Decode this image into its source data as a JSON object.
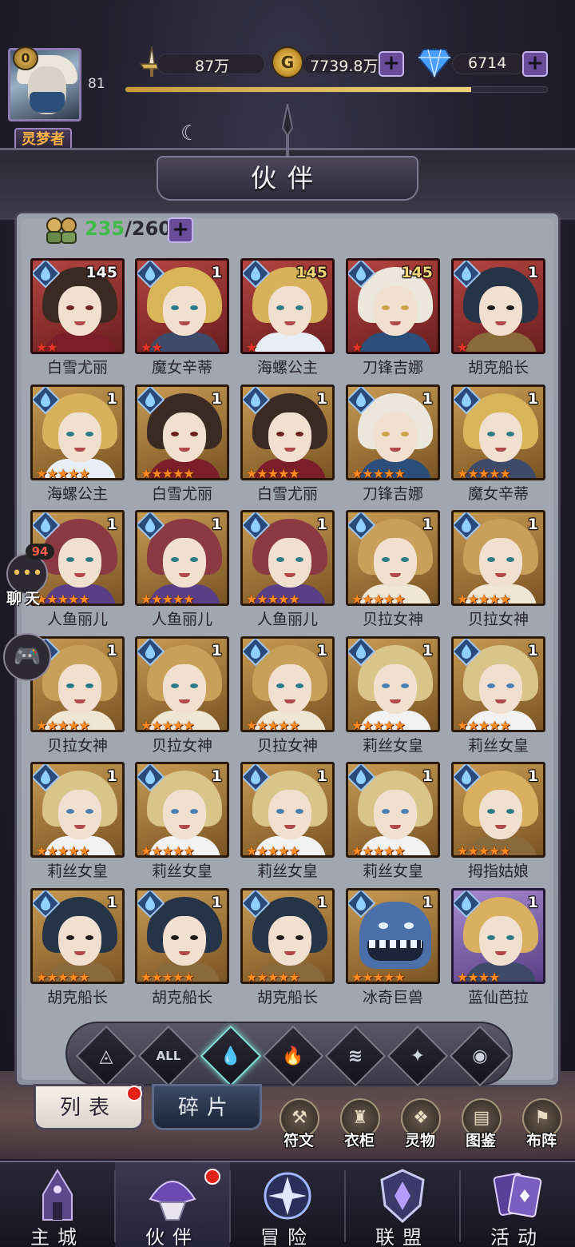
{
  "player": {
    "vip": "0",
    "level": "81",
    "title": "灵梦者",
    "exp_fraction": 0.82
  },
  "resources": {
    "power": "87万",
    "gold": "7739.8万",
    "gems": "6714",
    "plus": "+"
  },
  "page_title": "伙伴",
  "roster": {
    "current": "235",
    "max": "/260",
    "plus": "+"
  },
  "heroes": [
    {
      "name": "白雪尤丽",
      "level": "145",
      "stars": 2,
      "star_color": "red",
      "rarity": "red",
      "hair": "#3b2a24",
      "body": "#7a1f2a",
      "eye": "#6b2420"
    },
    {
      "name": "魔女辛蒂",
      "level": "1",
      "stars": 2,
      "star_color": "red",
      "rarity": "red",
      "hair": "#d9b55a",
      "body": "#3e4a6a",
      "eye": "#2c7b86"
    },
    {
      "name": "海螺公主",
      "level": "145",
      "stars": 1,
      "star_color": "red",
      "rarity": "red",
      "hair": "#d7b15c",
      "body": "#e7eef5",
      "eye": "#2c7b86"
    },
    {
      "name": "刀锋吉娜",
      "level": "145",
      "stars": 1,
      "star_color": "red",
      "rarity": "red",
      "hair": "#ece7dc",
      "body": "#2b4f7a",
      "eye": "#c9a24a"
    },
    {
      "name": "胡克船长",
      "level": "1",
      "stars": 1,
      "star_color": "red",
      "rarity": "red",
      "hair": "#263447",
      "body": "#8a6a3a",
      "eye": "#201a18"
    },
    {
      "name": "海螺公主",
      "level": "1",
      "stars": 5,
      "star_color": "orange",
      "rarity": "gold",
      "hair": "#d7b15c",
      "body": "#e7eef5",
      "eye": "#2c7b86"
    },
    {
      "name": "白雪尤丽",
      "level": "1",
      "stars": 5,
      "star_color": "orange",
      "rarity": "gold",
      "hair": "#3b2a24",
      "body": "#7a1f2a",
      "eye": "#6b2420"
    },
    {
      "name": "白雪尤丽",
      "level": "1",
      "stars": 5,
      "star_color": "orange",
      "rarity": "gold",
      "hair": "#3b2a24",
      "body": "#7a1f2a",
      "eye": "#6b2420"
    },
    {
      "name": "刀锋吉娜",
      "level": "1",
      "stars": 5,
      "star_color": "orange",
      "rarity": "gold",
      "hair": "#ece7dc",
      "body": "#2b4f7a",
      "eye": "#c9a24a"
    },
    {
      "name": "魔女辛蒂",
      "level": "1",
      "stars": 5,
      "star_color": "orange",
      "rarity": "gold",
      "hair": "#d9b55a",
      "body": "#3e4a6a",
      "eye": "#2c7b86"
    },
    {
      "name": "人鱼丽儿",
      "level": "1",
      "stars": 5,
      "star_color": "orange",
      "rarity": "gold",
      "hair": "#8b3a44",
      "body": "#5a3f86",
      "eye": "#2c7b86"
    },
    {
      "name": "人鱼丽儿",
      "level": "1",
      "stars": 5,
      "star_color": "orange",
      "rarity": "gold",
      "hair": "#8b3a44",
      "body": "#5a3f86",
      "eye": "#2c7b86"
    },
    {
      "name": "人鱼丽儿",
      "level": "1",
      "stars": 5,
      "star_color": "orange",
      "rarity": "gold",
      "hair": "#8b3a44",
      "body": "#5a3f86",
      "eye": "#2c7b86"
    },
    {
      "name": "贝拉女神",
      "level": "1",
      "stars": 5,
      "star_color": "orange",
      "rarity": "gold",
      "hair": "#c9a05a",
      "body": "#efe6d4",
      "eye": "#2c7b86"
    },
    {
      "name": "贝拉女神",
      "level": "1",
      "stars": 5,
      "star_color": "orange",
      "rarity": "gold",
      "hair": "#c9a05a",
      "body": "#efe6d4",
      "eye": "#2c7b86"
    },
    {
      "name": "贝拉女神",
      "level": "1",
      "stars": 5,
      "star_color": "orange",
      "rarity": "gold",
      "hair": "#c9a05a",
      "body": "#efe6d4",
      "eye": "#2c7b86"
    },
    {
      "name": "贝拉女神",
      "level": "1",
      "stars": 5,
      "star_color": "orange",
      "rarity": "gold",
      "hair": "#c9a05a",
      "body": "#efe6d4",
      "eye": "#2c7b86"
    },
    {
      "name": "贝拉女神",
      "level": "1",
      "stars": 5,
      "star_color": "orange",
      "rarity": "gold",
      "hair": "#c9a05a",
      "body": "#efe6d4",
      "eye": "#2c7b86"
    },
    {
      "name": "莉丝女皇",
      "level": "1",
      "stars": 5,
      "star_color": "orange",
      "rarity": "gold",
      "hair": "#d9c48a",
      "body": "#f2f2f2",
      "eye": "#4a7fb0"
    },
    {
      "name": "莉丝女皇",
      "level": "1",
      "stars": 5,
      "star_color": "orange",
      "rarity": "gold",
      "hair": "#d9c48a",
      "body": "#f2f2f2",
      "eye": "#4a7fb0"
    },
    {
      "name": "莉丝女皇",
      "level": "1",
      "stars": 5,
      "star_color": "orange",
      "rarity": "gold",
      "hair": "#d9c48a",
      "body": "#f2f2f2",
      "eye": "#4a7fb0"
    },
    {
      "name": "莉丝女皇",
      "level": "1",
      "stars": 5,
      "star_color": "orange",
      "rarity": "gold",
      "hair": "#d9c48a",
      "body": "#f2f2f2",
      "eye": "#4a7fb0"
    },
    {
      "name": "莉丝女皇",
      "level": "1",
      "stars": 5,
      "star_color": "orange",
      "rarity": "gold",
      "hair": "#d9c48a",
      "body": "#f2f2f2",
      "eye": "#4a7fb0"
    },
    {
      "name": "莉丝女皇",
      "level": "1",
      "stars": 5,
      "star_color": "orange",
      "rarity": "gold",
      "hair": "#d9c48a",
      "body": "#f2f2f2",
      "eye": "#4a7fb0"
    },
    {
      "name": "拇指姑娘",
      "level": "1",
      "stars": 5,
      "star_color": "orange",
      "rarity": "gold",
      "hair": "#d9b060",
      "body": "#8a6a3a",
      "eye": "#2c7b86"
    },
    {
      "name": "胡克船长",
      "level": "1",
      "stars": 5,
      "star_color": "orange",
      "rarity": "gold",
      "hair": "#263447",
      "body": "#8a6a3a",
      "eye": "#201a18"
    },
    {
      "name": "胡克船长",
      "level": "1",
      "stars": 5,
      "star_color": "orange",
      "rarity": "gold",
      "hair": "#263447",
      "body": "#8a6a3a",
      "eye": "#201a18"
    },
    {
      "name": "胡克船长",
      "level": "1",
      "stars": 5,
      "star_color": "orange",
      "rarity": "gold",
      "hair": "#263447",
      "body": "#8a6a3a",
      "eye": "#201a18"
    },
    {
      "name": "冰奇巨兽",
      "level": "1",
      "stars": 5,
      "star_color": "orange",
      "rarity": "gold",
      "hair": "#4b6fa8",
      "body": "#2f4a7a",
      "eye": "#e8f3ff",
      "monster": true
    },
    {
      "name": "蓝仙芭拉",
      "level": "1",
      "stars": 4,
      "star_color": "orange",
      "rarity": "purple",
      "hair": "#d9b060",
      "body": "#3e4a6a",
      "eye": "#2c7b86"
    }
  ],
  "filters": [
    {
      "id": "all-elements",
      "glyph": "◬"
    },
    {
      "id": "all",
      "glyph": "ALL"
    },
    {
      "id": "water",
      "glyph": "💧"
    },
    {
      "id": "fire",
      "glyph": "🔥"
    },
    {
      "id": "wind",
      "glyph": "≋"
    },
    {
      "id": "light",
      "glyph": "✦"
    },
    {
      "id": "dark",
      "glyph": "◉"
    }
  ],
  "tabs": {
    "list": "列表",
    "fragments": "碎片"
  },
  "side_buttons": [
    {
      "id": "runes",
      "label": "符文",
      "glyph": "⚒"
    },
    {
      "id": "wardrobe",
      "label": "衣柜",
      "glyph": "♜"
    },
    {
      "id": "spirit",
      "label": "灵物",
      "glyph": "❖"
    },
    {
      "id": "codex",
      "label": "图鉴",
      "glyph": "▤"
    },
    {
      "id": "formation",
      "label": "布阵",
      "glyph": "⚑"
    }
  ],
  "chat": {
    "label": "聊天",
    "badge": "94"
  },
  "nav": [
    {
      "id": "main-city",
      "label": "主城"
    },
    {
      "id": "partners",
      "label": "伙伴"
    },
    {
      "id": "adventure",
      "label": "冒险"
    },
    {
      "id": "alliance",
      "label": "联盟"
    },
    {
      "id": "events",
      "label": "活动"
    }
  ],
  "colors": {
    "accent_purple": "#6a4d9a",
    "roster_green": "#3fbb4a",
    "badge_red": "#e2231a",
    "gold_level": "#f4d774"
  }
}
